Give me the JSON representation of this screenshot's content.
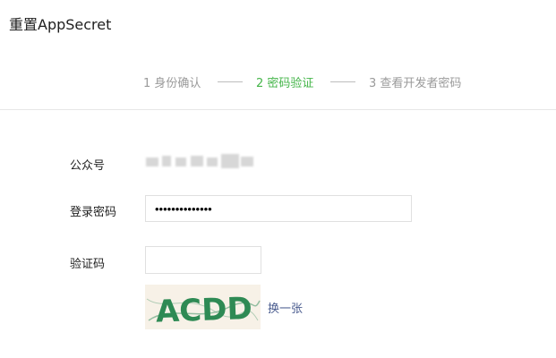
{
  "header": {
    "title": "重置AppSecret"
  },
  "steps": [
    {
      "label": "1 身份确认",
      "state": "done"
    },
    {
      "label": "2 密码验证",
      "state": "active"
    },
    {
      "label": "3 查看开发者密码",
      "state": "pending"
    }
  ],
  "colors": {
    "active_step": "#44b549",
    "inactive_step": "#9a9a9a",
    "link": "#4a5c8f",
    "captcha_text": "#2e8a54",
    "captcha_bg": "#f7f1e7"
  },
  "form": {
    "account_label": "公众号",
    "password_label": "登录密码",
    "password_value": "••••••••••••••",
    "captcha_label": "验证码",
    "captcha_value": "",
    "captcha_image_text": "ACDD",
    "refresh_link": "换一张"
  }
}
